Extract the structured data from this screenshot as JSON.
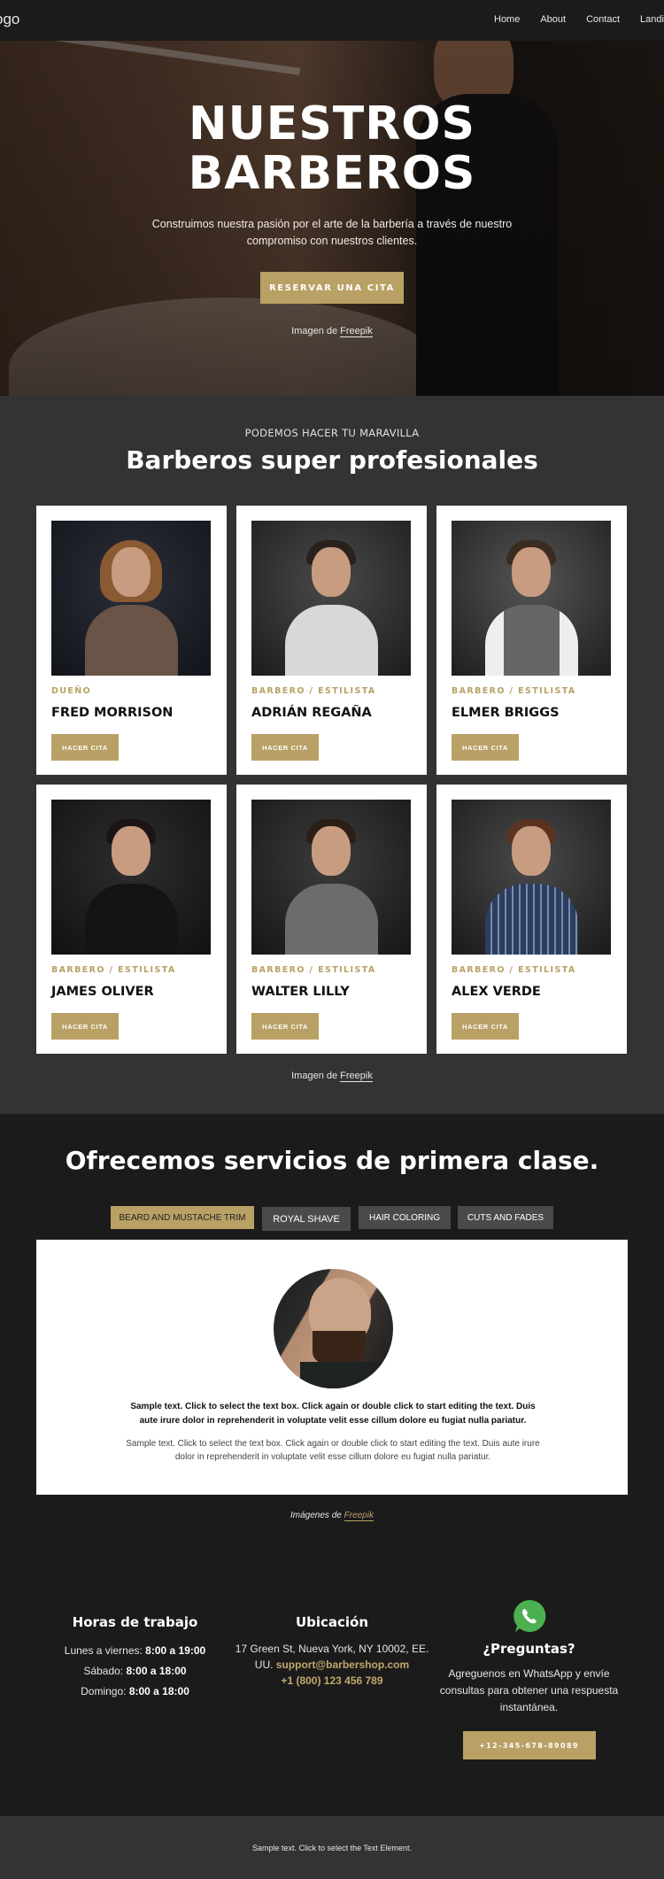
{
  "header": {
    "logo": "ogo",
    "nav": [
      "Home",
      "About",
      "Contact",
      "Landing"
    ]
  },
  "hero": {
    "title_line1": "NUESTROS",
    "title_line2": "BARBEROS",
    "subtitle": "Construimos nuestra pasión por el arte de la barbería a través de nuestro compromiso con nuestros clientes.",
    "cta_label": "RESERVAR UNA CITA",
    "credit_prefix": "Imagen de ",
    "credit_link": "Freepik"
  },
  "team": {
    "eyebrow": "PODEMOS HACER TU MARAVILLA",
    "title": "Barberos super profesionales",
    "button_label": "HACER CITA",
    "members": [
      {
        "role": "DUEÑO",
        "name": "FRED MORRISON"
      },
      {
        "role": "BARBERO / ESTILISTA",
        "name": "ADRIÁN REGAÑA"
      },
      {
        "role": "BARBERO / ESTILISTA",
        "name": "ELMER BRIGGS"
      },
      {
        "role": "BARBERO / ESTILISTA",
        "name": "JAMES OLIVER"
      },
      {
        "role": "BARBERO / ESTILISTA",
        "name": "WALTER LILLY"
      },
      {
        "role": "BARBERO / ESTILISTA",
        "name": "ALEX VERDE"
      }
    ],
    "credit_prefix": "Imagen de ",
    "credit_link": "Freepik"
  },
  "services": {
    "title": "Ofrecemos servicios de primera clase.",
    "tabs": [
      {
        "label": "BEARD AND MUSTACHE TRIM",
        "active": true
      },
      {
        "label": "ROYAL SHAVE",
        "active": false
      },
      {
        "label": "HAIR COLORING",
        "active": false
      },
      {
        "label": "CUTS AND FADES",
        "active": false
      }
    ],
    "panel_bold": "Sample text. Click to select the text box. Click again or double click to start editing the text. Duis aute irure dolor in reprehenderit in voluptate velit esse cillum dolore eu fugiat nulla pariatur.",
    "panel_text": "Sample text. Click to select the text box. Click again or double click to start editing the text. Duis aute irure dolor in reprehenderit in voluptate velit esse cillum dolore eu fugiat nulla pariatur.",
    "credit_prefix": "Imágenes de ",
    "credit_link": "Freepik"
  },
  "contact": {
    "hours": {
      "title": "Horas de trabajo",
      "rows": [
        {
          "label": "Lunes a viernes: ",
          "value": "8:00 a 19:00"
        },
        {
          "label": "Sábado: ",
          "value": "8:00 a 18:00"
        },
        {
          "label": "Domingo: ",
          "value": "8:00 a 18:00"
        }
      ]
    },
    "location": {
      "title": "Ubicación",
      "address": "17 Green St, Nueva York, NY 10002, EE. UU. ",
      "email": "support@barbershop.com",
      "phone": "+1 (800) 123 456 789"
    },
    "questions": {
      "icon": "whatsapp-icon",
      "title": "¿Preguntas?",
      "text": "Agreguenos en WhatsApp y envíe consultas para obtener una respuesta instantánea.",
      "button_label": "+12-345-678-89089"
    }
  },
  "footer": {
    "text": "Sample text. Click to select the Text Element."
  },
  "colors": {
    "accent": "#b9a165",
    "dark": "#1b1b1b",
    "section": "#333333",
    "whatsapp": "#4caf50"
  }
}
